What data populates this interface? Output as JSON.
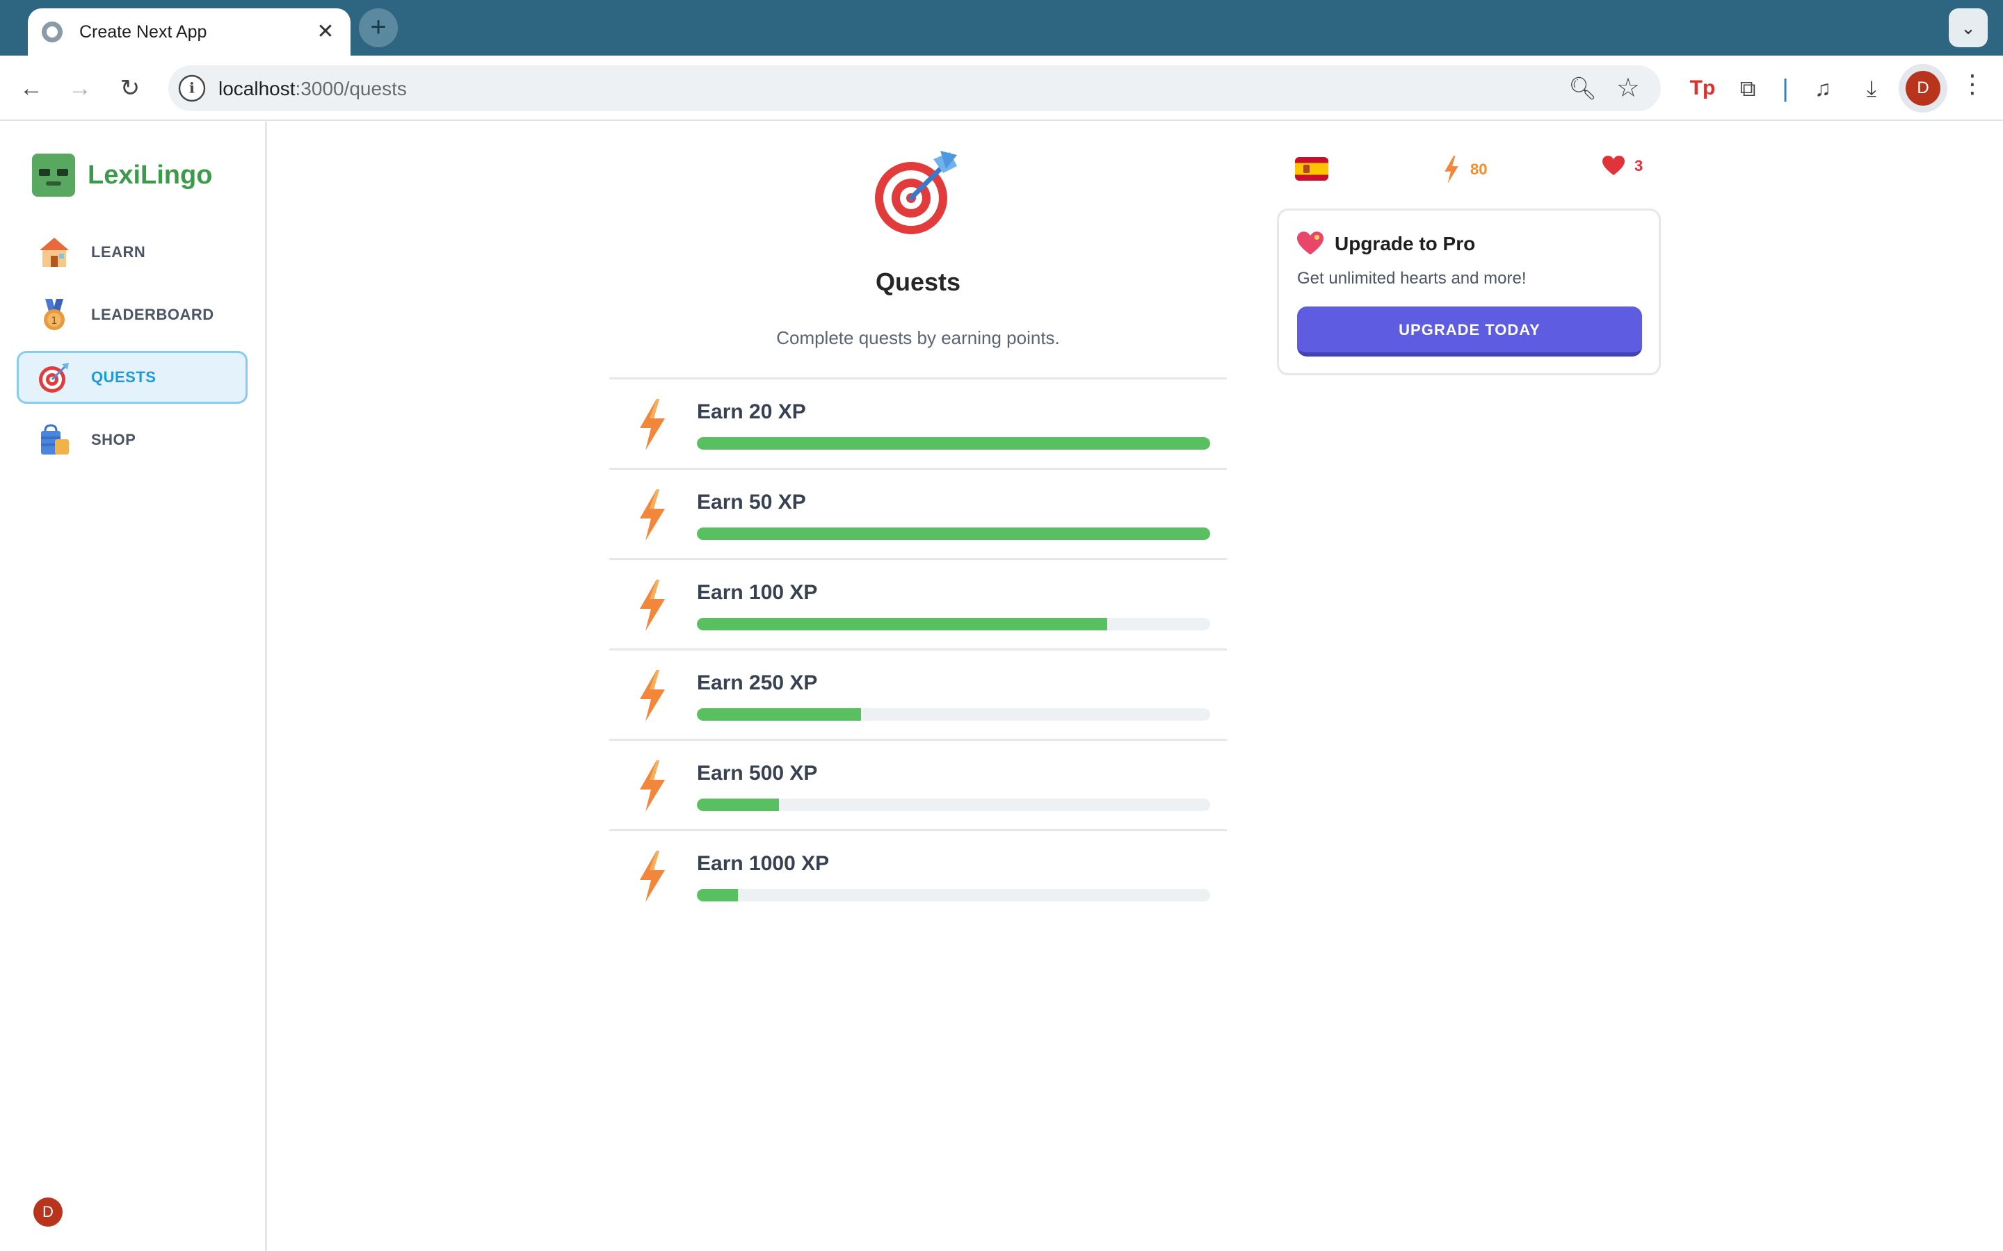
{
  "browser": {
    "tab_title": "Create Next App",
    "tab_close": "✕",
    "new_tab": "+",
    "tab_menu": "⌄",
    "back": "←",
    "forward": "→",
    "reload": "↻",
    "info_icon": "i",
    "url_host": "localhost",
    "url_path": ":3000/quests",
    "zoom_icon": "🔍︎",
    "star_icon": "☆",
    "ext_tp": "Tp",
    "ext_puzzle": "⧉",
    "ext_separator": "|",
    "ext_media": "♫",
    "ext_download": "⤓",
    "profile_initial": "D",
    "menu": "⋮"
  },
  "sidebar": {
    "brand": "LexiLingo",
    "items": [
      {
        "label": "LEARN",
        "icon": "house-icon",
        "active": false
      },
      {
        "label": "LEADERBOARD",
        "icon": "medal-icon",
        "active": false
      },
      {
        "label": "QUESTS",
        "icon": "target-icon",
        "active": true
      },
      {
        "label": "SHOP",
        "icon": "shopping-bag-icon",
        "active": false
      }
    ],
    "user_initial": "D"
  },
  "main": {
    "title": "Quests",
    "subtitle": "Complete quests by earning points.",
    "quests": [
      {
        "label": "Earn 20 XP",
        "progress": 1.0
      },
      {
        "label": "Earn 50 XP",
        "progress": 1.0
      },
      {
        "label": "Earn 100 XP",
        "progress": 0.8
      },
      {
        "label": "Earn 250 XP",
        "progress": 0.32
      },
      {
        "label": "Earn 500 XP",
        "progress": 0.16
      },
      {
        "label": "Earn 1000 XP",
        "progress": 0.08
      }
    ]
  },
  "stats": {
    "language_flag": "spain-flag",
    "points": "80",
    "hearts": "3"
  },
  "promo": {
    "title": "Upgrade to Pro",
    "description": "Get unlimited hearts and more!",
    "button": "UPGRADE TODAY"
  },
  "colors": {
    "brand_green": "#3c9a4b",
    "progress_green": "#58c060",
    "active_blue": "#1f9ad6",
    "cta_purple": "#5e5ce0",
    "xp_orange": "#f28b2b",
    "heart_red": "#e0343a",
    "browser_frame": "#2e6580"
  }
}
